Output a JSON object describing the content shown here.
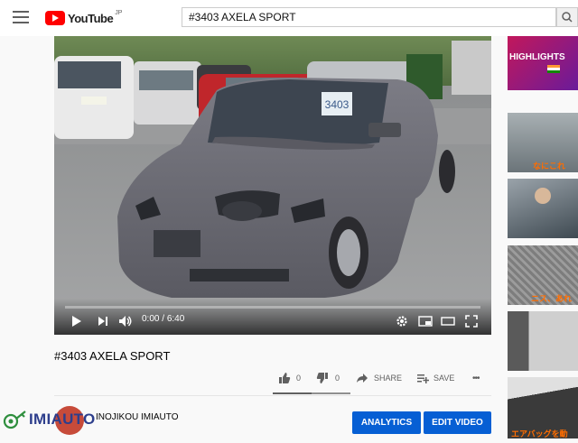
{
  "masthead": {
    "logo_text": "YouTube",
    "country_code": "JP",
    "search_value": "#3403 AXELA SPORT"
  },
  "player": {
    "plate_text": "3403",
    "time_current": "0:00",
    "time_separator": "/",
    "time_duration": "6:40",
    "progress_fraction": 0.0
  },
  "video": {
    "title": "#3403 AXELA SPORT",
    "like_count": "0",
    "dislike_count": "0",
    "share_label": "SHARE",
    "save_label": "SAVE",
    "more_label": "•••"
  },
  "channel": {
    "name": "INOJIKOU IMIAUTO"
  },
  "buttons": {
    "analytics_label": "ANALYTICS",
    "edit_label": "EDIT VIDEO"
  },
  "sidebar": {
    "thumbs": [
      {
        "caption": "HIGHLIGHTS"
      },
      {
        "caption": "なにこれ"
      },
      {
        "caption": ""
      },
      {
        "caption": "ニス、あれ"
      },
      {
        "caption": ""
      },
      {
        "caption": "エアバッグを動"
      }
    ]
  },
  "watermark": {
    "text": "IMIAUTO"
  },
  "colors": {
    "accent": "#065fd4",
    "brand_red": "#ff0000"
  }
}
